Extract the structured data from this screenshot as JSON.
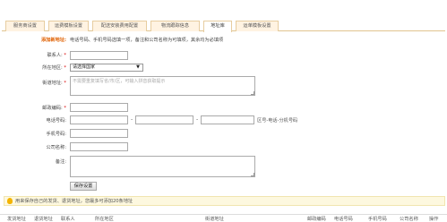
{
  "tabs": [
    {
      "label": "服务商设置"
    },
    {
      "label": "运费模板设置"
    },
    {
      "label": "配送安装费用配置"
    },
    {
      "label": "物流跟踪信息"
    },
    {
      "label": "地址库"
    },
    {
      "label": "运单模板设置"
    }
  ],
  "form": {
    "add_label": "添加新地址:",
    "note": "电话号码、手机号码选填一项，备注和公司名称为可填项，其余均为必填项",
    "contact_label": "联系人:",
    "region_label": "所在地区:",
    "region_value": "请选择国家",
    "street_label": "街道地址:",
    "street_placeholder": "不需要重复填写省/市/区，可输入拼音获取提示",
    "zip_label": "邮政编码:",
    "phone_label": "电话号码:",
    "phone_hint": "区号-电话-分机号码",
    "mobile_label": "手机号码:",
    "company_label": "公司名称:",
    "remark_label": "备注:",
    "save_label": "保存设置",
    "required_mark": "*",
    "dash": "-"
  },
  "notice": {
    "text": "用来保存自己的发货、退货地址，您最多可添加20条地址"
  },
  "table_headers": [
    "发货地址",
    "退货地址",
    "联系人",
    "所在地区",
    "街道地址",
    "邮政编码",
    "电话号码",
    "手机号码",
    "公司名称",
    "操作"
  ]
}
